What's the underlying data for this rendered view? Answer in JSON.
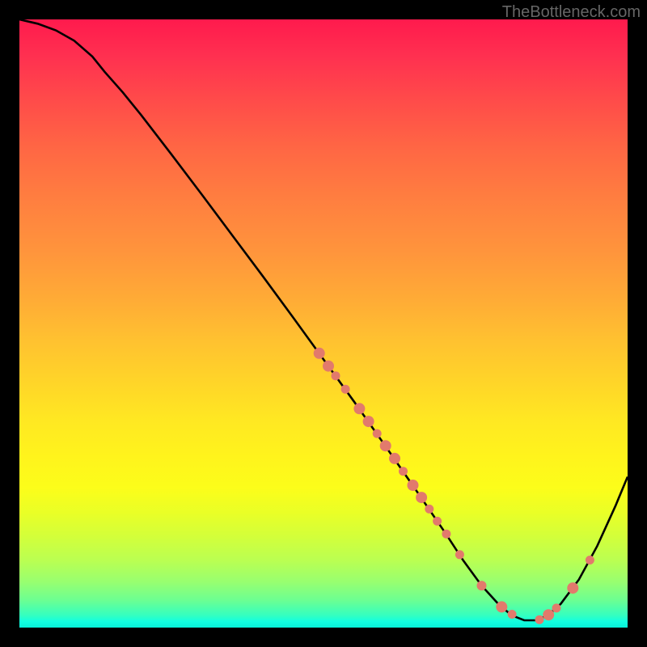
{
  "watermark": "TheBottleneck.com",
  "chart_data": {
    "type": "line",
    "title": "",
    "xlabel": "",
    "ylabel": "",
    "xlim": [
      0,
      100
    ],
    "ylim": [
      0,
      100
    ],
    "curve": [
      {
        "x": 0,
        "y": 100
      },
      {
        "x": 3,
        "y": 99.3
      },
      {
        "x": 6,
        "y": 98.2
      },
      {
        "x": 9,
        "y": 96.5
      },
      {
        "x": 12,
        "y": 93.9
      },
      {
        "x": 14,
        "y": 91.4
      },
      {
        "x": 17,
        "y": 88.0
      },
      {
        "x": 20,
        "y": 84.3
      },
      {
        "x": 25,
        "y": 77.8
      },
      {
        "x": 30,
        "y": 71.2
      },
      {
        "x": 35,
        "y": 64.5
      },
      {
        "x": 40,
        "y": 57.8
      },
      {
        "x": 45,
        "y": 51.0
      },
      {
        "x": 50,
        "y": 44.1
      },
      {
        "x": 55,
        "y": 37.2
      },
      {
        "x": 60,
        "y": 30.1
      },
      {
        "x": 65,
        "y": 22.9
      },
      {
        "x": 70,
        "y": 15.6
      },
      {
        "x": 73,
        "y": 11.0
      },
      {
        "x": 76,
        "y": 6.9
      },
      {
        "x": 79,
        "y": 3.6
      },
      {
        "x": 81,
        "y": 2.0
      },
      {
        "x": 83,
        "y": 1.2
      },
      {
        "x": 85,
        "y": 1.2
      },
      {
        "x": 87,
        "y": 2.1
      },
      {
        "x": 89,
        "y": 3.9
      },
      {
        "x": 92,
        "y": 7.9
      },
      {
        "x": 95,
        "y": 13.4
      },
      {
        "x": 98,
        "y": 20.0
      },
      {
        "x": 100,
        "y": 24.8
      }
    ],
    "dots": [
      {
        "x": 49.3,
        "y": 45.1,
        "r": 7
      },
      {
        "x": 50.8,
        "y": 43.0,
        "r": 7
      },
      {
        "x": 52.0,
        "y": 41.4,
        "r": 5.5
      },
      {
        "x": 53.6,
        "y": 39.2,
        "r": 5.5
      },
      {
        "x": 55.9,
        "y": 36.0,
        "r": 7
      },
      {
        "x": 57.4,
        "y": 33.9,
        "r": 7
      },
      {
        "x": 58.8,
        "y": 31.9,
        "r": 5.5
      },
      {
        "x": 60.2,
        "y": 29.9,
        "r": 7
      },
      {
        "x": 61.7,
        "y": 27.8,
        "r": 7
      },
      {
        "x": 63.1,
        "y": 25.7,
        "r": 5.5
      },
      {
        "x": 64.7,
        "y": 23.4,
        "r": 7
      },
      {
        "x": 66.1,
        "y": 21.4,
        "r": 7
      },
      {
        "x": 67.4,
        "y": 19.5,
        "r": 5.5
      },
      {
        "x": 68.7,
        "y": 17.5,
        "r": 5.5
      },
      {
        "x": 70.2,
        "y": 15.4,
        "r": 5.5
      },
      {
        "x": 72.4,
        "y": 12.0,
        "r": 5.5
      },
      {
        "x": 76.0,
        "y": 6.9,
        "r": 6
      },
      {
        "x": 79.3,
        "y": 3.4,
        "r": 7
      },
      {
        "x": 81.0,
        "y": 2.2,
        "r": 5.5
      },
      {
        "x": 85.5,
        "y": 1.3,
        "r": 5.5
      },
      {
        "x": 87.0,
        "y": 2.1,
        "r": 7
      },
      {
        "x": 88.3,
        "y": 3.2,
        "r": 5.5
      },
      {
        "x": 91.0,
        "y": 6.5,
        "r": 7
      },
      {
        "x": 93.8,
        "y": 11.1,
        "r": 5.5
      }
    ]
  }
}
